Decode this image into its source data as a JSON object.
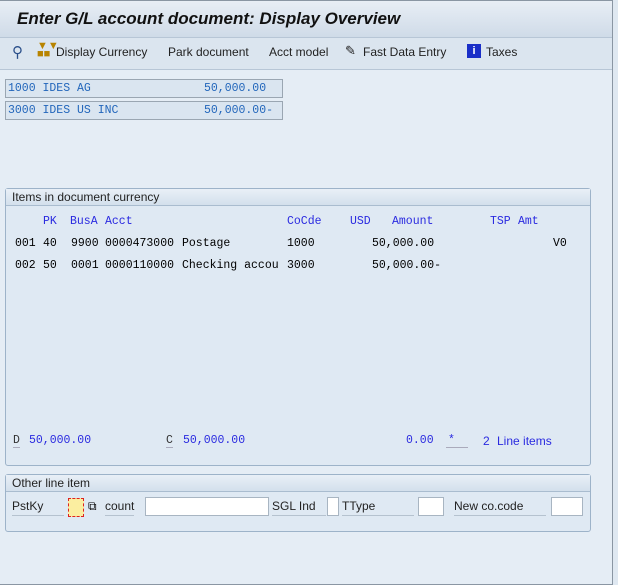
{
  "title": "Enter G/L account document: Display Overview",
  "toolbar": {
    "display_currency": "Display Currency",
    "park": "Park document",
    "acct_model": "Acct model",
    "fast_entry": "Fast Data Entry",
    "taxes": "Taxes"
  },
  "company_codes": [
    {
      "code": "1000 IDES AG",
      "amount": "50,000.00"
    },
    {
      "code": "3000 IDES US INC",
      "amount": "50,000.00-"
    }
  ],
  "items": {
    "title": "Items in document currency",
    "headers": {
      "pk": "PK",
      "busa": "BusA",
      "acct": "Acct",
      "cocde": "CoCde",
      "usd": "USD",
      "amount": "Amount",
      "tsp": "TSP",
      "amt": "Amt"
    },
    "rows": [
      {
        "no": "001",
        "pk": "40",
        "busa": "9900",
        "acct": "0000473000",
        "text": "Postage",
        "cocde": "1000",
        "amount": "50,000.00",
        "tax": "V0"
      },
      {
        "no": "002",
        "pk": "50",
        "busa": "0001",
        "acct": "0000110000",
        "text": "Checking accou",
        "cocde": "3000",
        "amount": "50,000.00-",
        "tax": ""
      }
    ],
    "totals": {
      "d_label": "D",
      "debit": "50,000.00",
      "c_label": "C",
      "credit": "50,000.00",
      "balance": "0.00",
      "star": "*",
      "count": "2",
      "line_items": "Line items"
    }
  },
  "other": {
    "title": "Other line item",
    "pstky": "PstKy",
    "account": "count",
    "sgl": "SGL Ind",
    "ttype": "TType",
    "newcc": "New co.code"
  }
}
